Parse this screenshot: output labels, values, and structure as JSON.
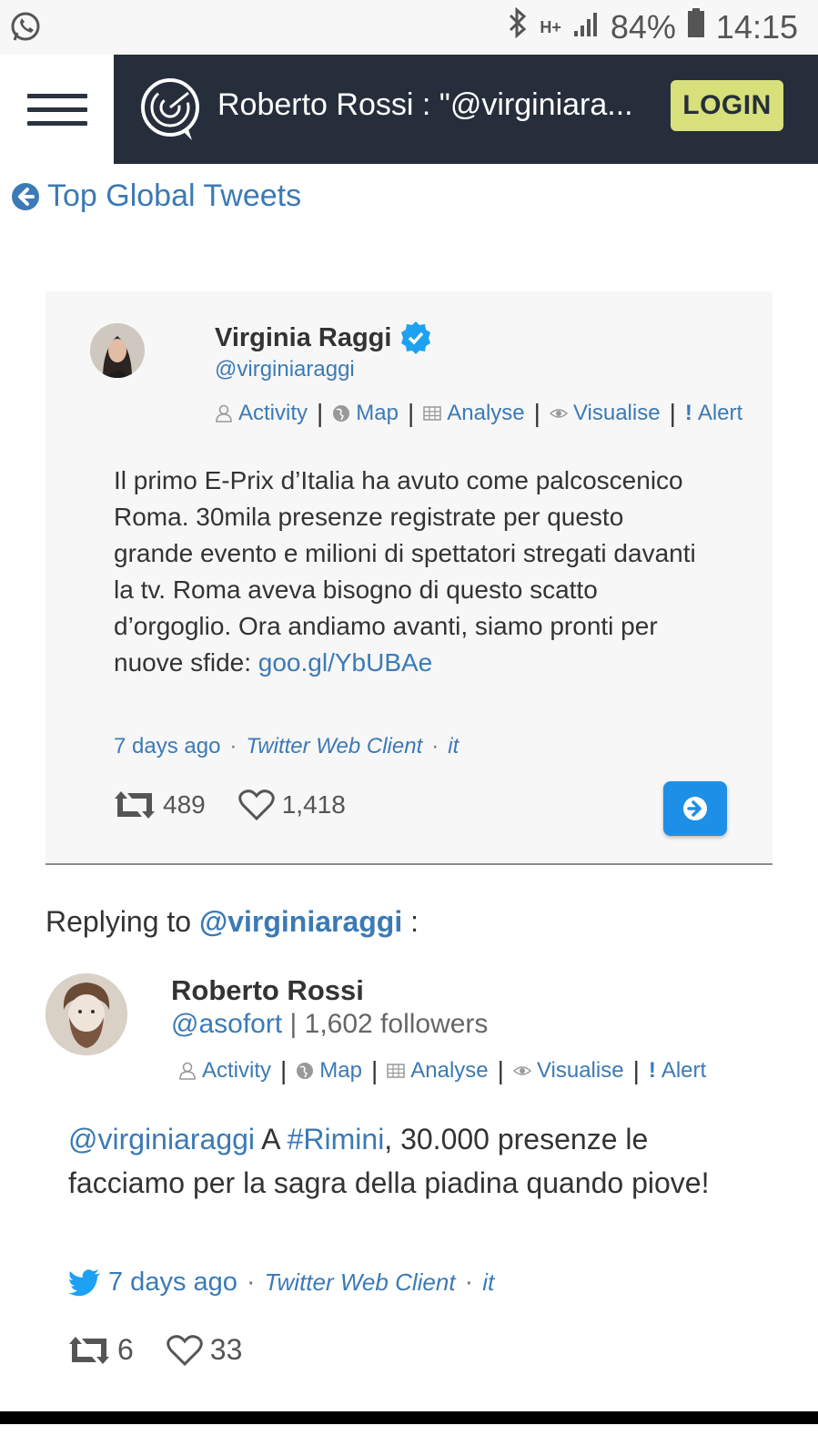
{
  "status_bar": {
    "network": "H+",
    "battery": "84%",
    "time": "14:15"
  },
  "header": {
    "title": "Roberto Rossi : \"@virginiara...",
    "login_label": "LOGIN",
    "colors": {
      "bar_bg": "#262e3b",
      "login_bg": "#d7e07a"
    }
  },
  "back_link": {
    "label": "Top Global Tweets"
  },
  "original_tweet": {
    "author_name": "Virginia Raggi",
    "author_handle": "@virginiaraggi",
    "verified": true,
    "actions": [
      "Activity",
      "Map",
      "Analyse",
      "Visualise",
      "Alert"
    ],
    "text": "Il primo E-Prix d’Italia ha avuto come palcoscenico Roma. 30mila presenze registrate per questo grande evento e milioni di spettatori stregati davanti la tv. Roma aveva bisogno di questo scatto d’orgoglio. Ora andiamo avanti, siamo pronti per nuove sfide: ",
    "link": "goo.gl/YbUBAe",
    "time": "7 days ago",
    "client": "Twitter Web Client",
    "lang": "it",
    "retweets": "489",
    "likes": "1,418"
  },
  "replying_to": {
    "prefix": "Replying to",
    "mention": "@virginiaraggi",
    "suffix": ":"
  },
  "reply_tweet": {
    "author_name": "Roberto Rossi",
    "author_handle": "@asofort",
    "followers": "| 1,602 followers",
    "actions": [
      "Activity",
      "Map",
      "Analyse",
      "Visualise",
      "Alert"
    ],
    "mention": "@virginiaraggi",
    "text_a": " A ",
    "hashtag": "#Rimini",
    "text_b": ", 30.000 presenze le facciamo per la sagra della piadina quando piove!",
    "time": "7 days ago",
    "client": "Twitter Web Client",
    "lang": "it",
    "retweets": "6",
    "likes": "33"
  }
}
